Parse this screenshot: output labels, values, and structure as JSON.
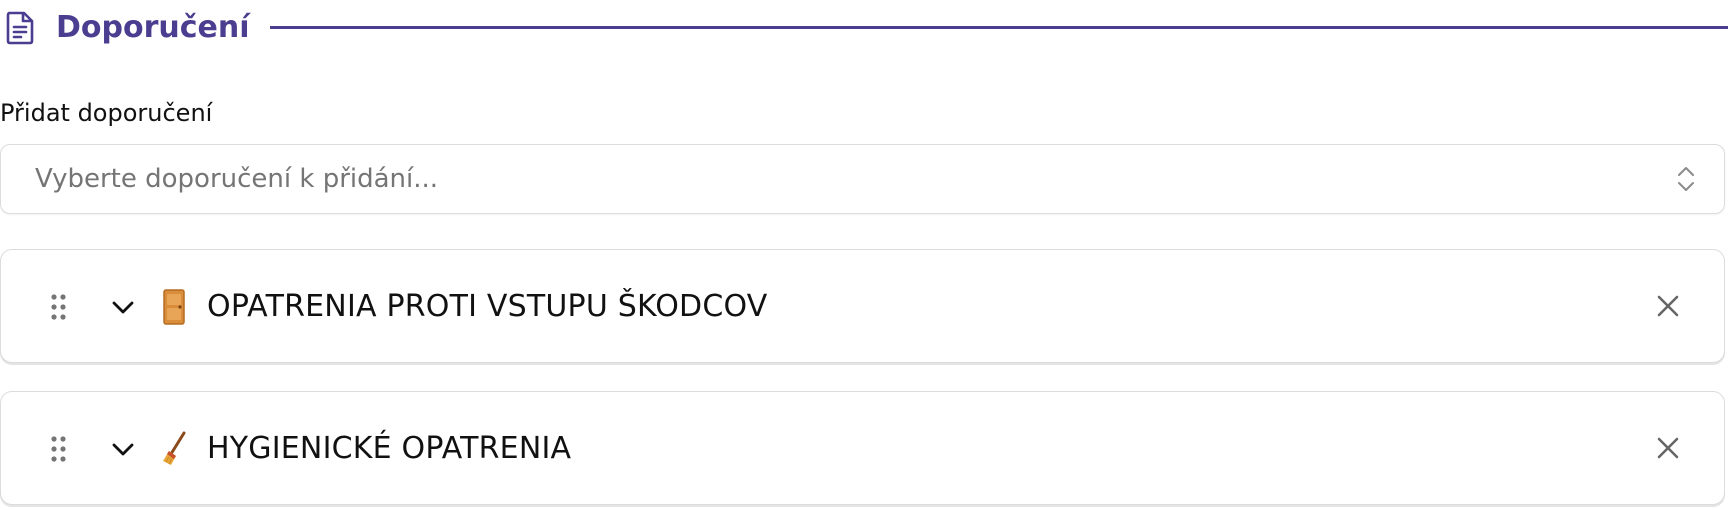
{
  "section": {
    "title": "Doporučení",
    "icon": "document-icon",
    "accent_color": "#4b3d8f"
  },
  "add_field": {
    "label": "Přidat doporučení",
    "placeholder": "Vyberte doporučení k přidání...",
    "chevron_icon": "chevron-up-down-icon"
  },
  "recommendations": [
    {
      "emoji_icon": "door-icon",
      "title": "OPATRENIA PROTI VSTUPU ŠKODCOV"
    },
    {
      "emoji_icon": "broom-icon",
      "title": "HYGIENICKÉ OPATRENIA"
    }
  ],
  "controls": {
    "drag_icon": "drag-handle-icon",
    "expand_icon": "chevron-down-icon",
    "remove_icon": "close-icon"
  }
}
